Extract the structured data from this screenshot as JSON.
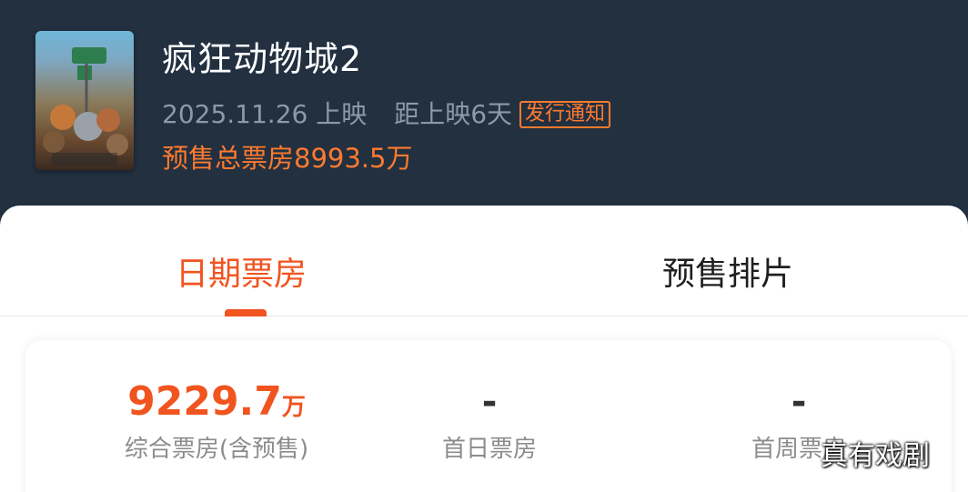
{
  "movie": {
    "title": "疯狂动物城2",
    "release_date": "2025.11.26 上映",
    "countdown": "距上映6天",
    "release_notice": "发行通知",
    "presale_total": "预售总票房8993.5万"
  },
  "tabs": [
    {
      "label": "日期票房",
      "active": true
    },
    {
      "label": "预售排片",
      "active": false
    }
  ],
  "stats": [
    {
      "value": "9229.7",
      "unit": "万",
      "label": "综合票房(含预售)"
    },
    {
      "value": "-",
      "label": "首日票房"
    },
    {
      "value": "-",
      "label": "首周票房"
    }
  ],
  "watermark": "真有戏剧",
  "colors": {
    "accent": "#f1541f",
    "header_bg": "#223040"
  }
}
